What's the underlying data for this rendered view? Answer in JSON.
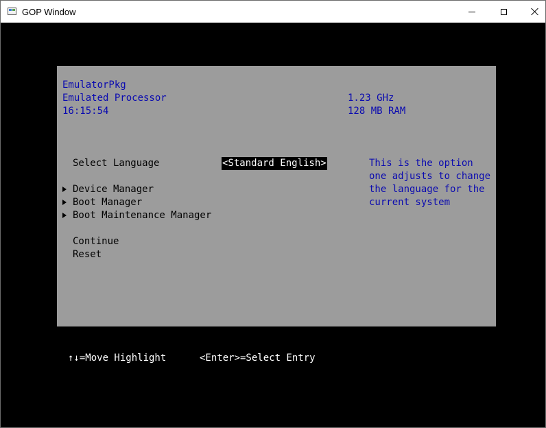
{
  "window": {
    "title": "GOP Window"
  },
  "header": {
    "platform": "EmulatorPkg",
    "processor": "Emulated Processor",
    "time": "16:15:54",
    "cpu_speed": "1.23 GHz",
    "memory": "128 MB RAM"
  },
  "menu": {
    "select_language_label": "Select Language",
    "language_value": "<Standard English>",
    "items": [
      {
        "label": "Device Manager"
      },
      {
        "label": "Boot Manager"
      },
      {
        "label": "Boot Maintenance Manager"
      }
    ],
    "continue_label": "Continue",
    "reset_label": "Reset"
  },
  "help": {
    "lines": [
      "This is the option",
      "one adjusts to change",
      "the language for the",
      "current system"
    ]
  },
  "footer": {
    "move_hint": "↑↓=Move Highlight",
    "select_hint": "<Enter>=Select Entry"
  },
  "colors": {
    "panel_background": "#9c9c9c",
    "info_text": "#0a0ab0",
    "screen_background": "#000000"
  }
}
